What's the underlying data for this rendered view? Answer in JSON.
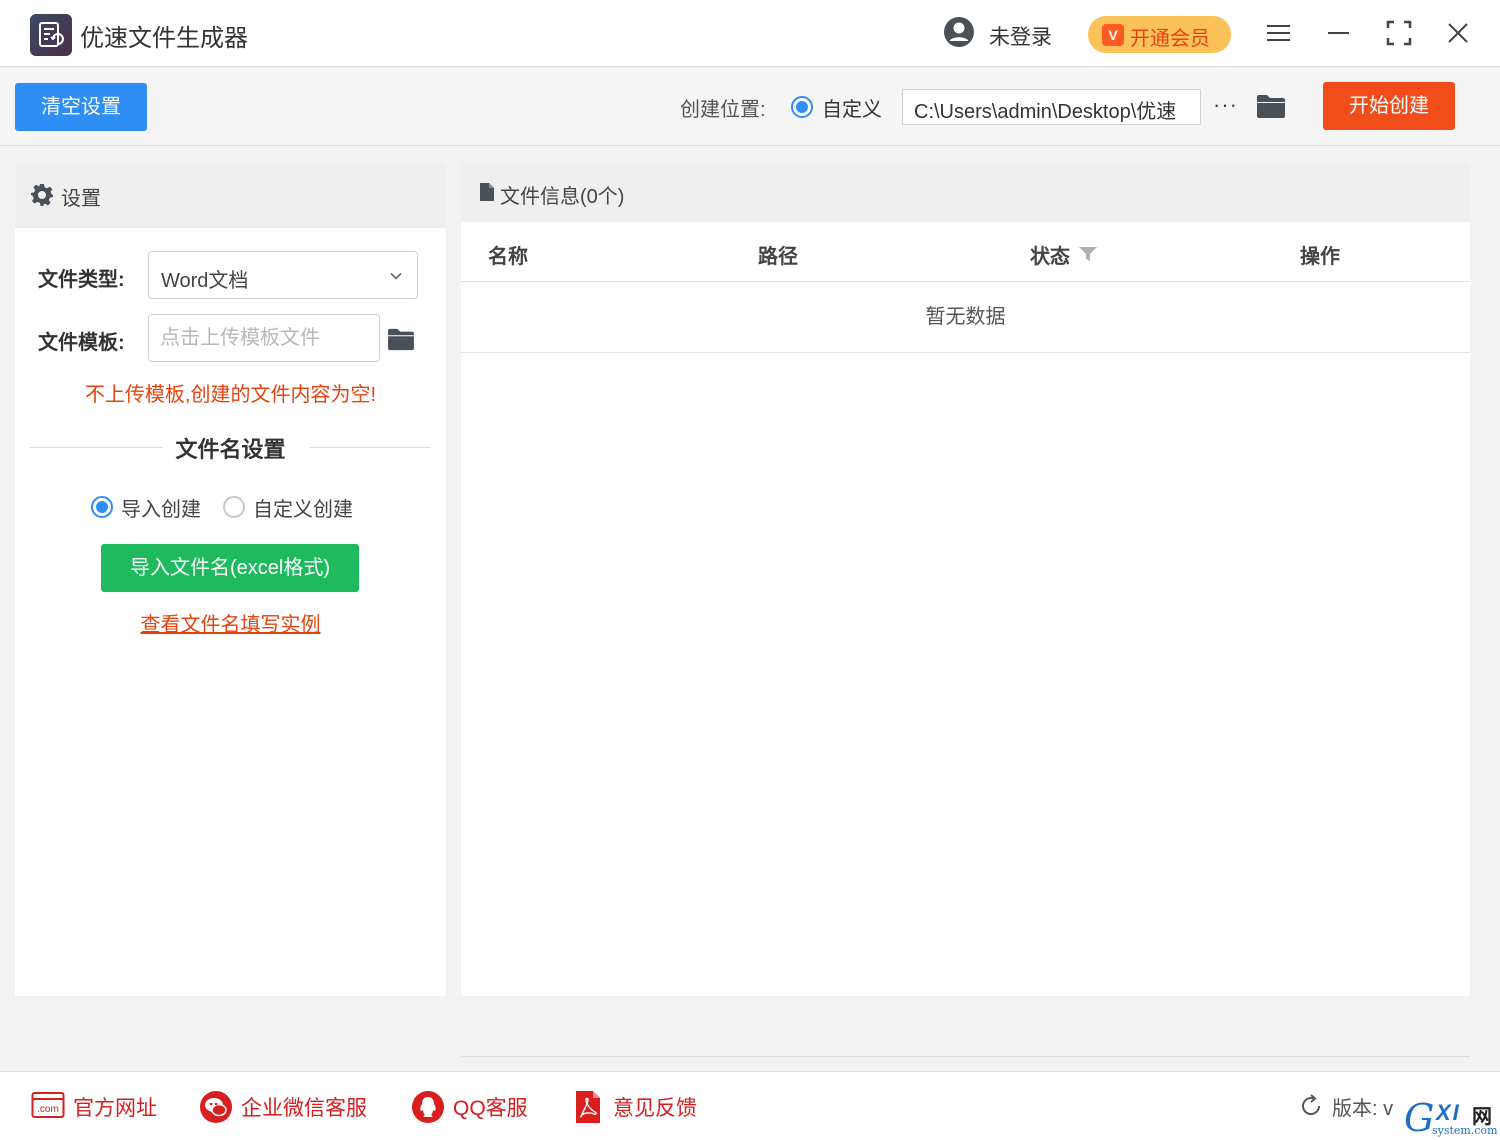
{
  "titlebar": {
    "title": "优速文件生成器",
    "user_status": "未登录",
    "vip_icon_text": "V",
    "vip_label": "开通会员",
    "icons": [
      "user-icon",
      "menu-icon",
      "minimize-icon",
      "maximize-icon",
      "close-icon"
    ]
  },
  "toolbar": {
    "clear_label": "清空设置",
    "location_label": "创建位置:",
    "location_option": "自定义",
    "path_value": "C:\\Users\\admin\\Desktop\\优速",
    "more_label": "···",
    "start_label": "开始创建"
  },
  "settings": {
    "header": "设置",
    "file_type_label": "文件类型:",
    "file_type_value": "Word文档",
    "template_label": "文件模板:",
    "template_placeholder": "点击上传模板文件",
    "warning": "不上传模板,创建的文件内容为空!",
    "filename_section": "文件名设置",
    "mode_import": "导入创建",
    "mode_custom": "自定义创建",
    "import_button": "导入文件名(excel格式)",
    "example_link": "查看文件名填写实例"
  },
  "fileinfo": {
    "header": "文件信息(0个)",
    "columns": [
      "名称",
      "路径",
      "状态",
      "操作"
    ],
    "empty_text": "暂无数据"
  },
  "footer": {
    "items": [
      "官方网址",
      "企业微信客服",
      "QQ客服",
      "意见反馈"
    ],
    "com_label": ".com",
    "version_label": "版本: v",
    "watermark_g": "G",
    "watermark_xi": "XI",
    "watermark_net": "网",
    "watermark_domain": "system.com"
  },
  "colors": {
    "primary_blue": "#2e8ef5",
    "start_orange": "#f04d1a",
    "import_green": "#1fba5d",
    "warning_red": "#e8430e",
    "vip_yellow": "#fcc25a"
  }
}
